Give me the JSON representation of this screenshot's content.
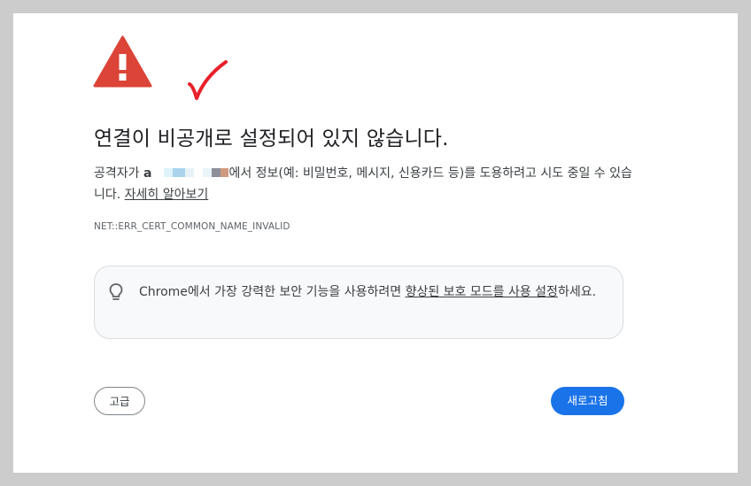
{
  "interstitial": {
    "title": "연결이 비공개로 설정되어 있지 않습니다.",
    "body_prefix": "공격자가 ",
    "host_visible": "a",
    "body_suffix": "에서 정보(예: 비밀번호, 메시지, 신용카드 등)를 도용하려고 시도 중일 수 있습니다. ",
    "learn_more_link": "자세히 알아보기",
    "error_code": "NET::ERR_CERT_COMMON_NAME_INVALID"
  },
  "hint": {
    "icon": "lightbulb-icon",
    "text_prefix": "Chrome에서 가장 강력한 보안 기능을 사용하려면 ",
    "link": "향상된 보호 모드를 사용 설정",
    "text_suffix": "하세요."
  },
  "buttons": {
    "advanced_label": "고급",
    "reload_label": "새로고침"
  },
  "colors": {
    "warning_red": "#db4437",
    "annotation_red": "#e8202a",
    "primary_blue": "#1a73e8"
  }
}
